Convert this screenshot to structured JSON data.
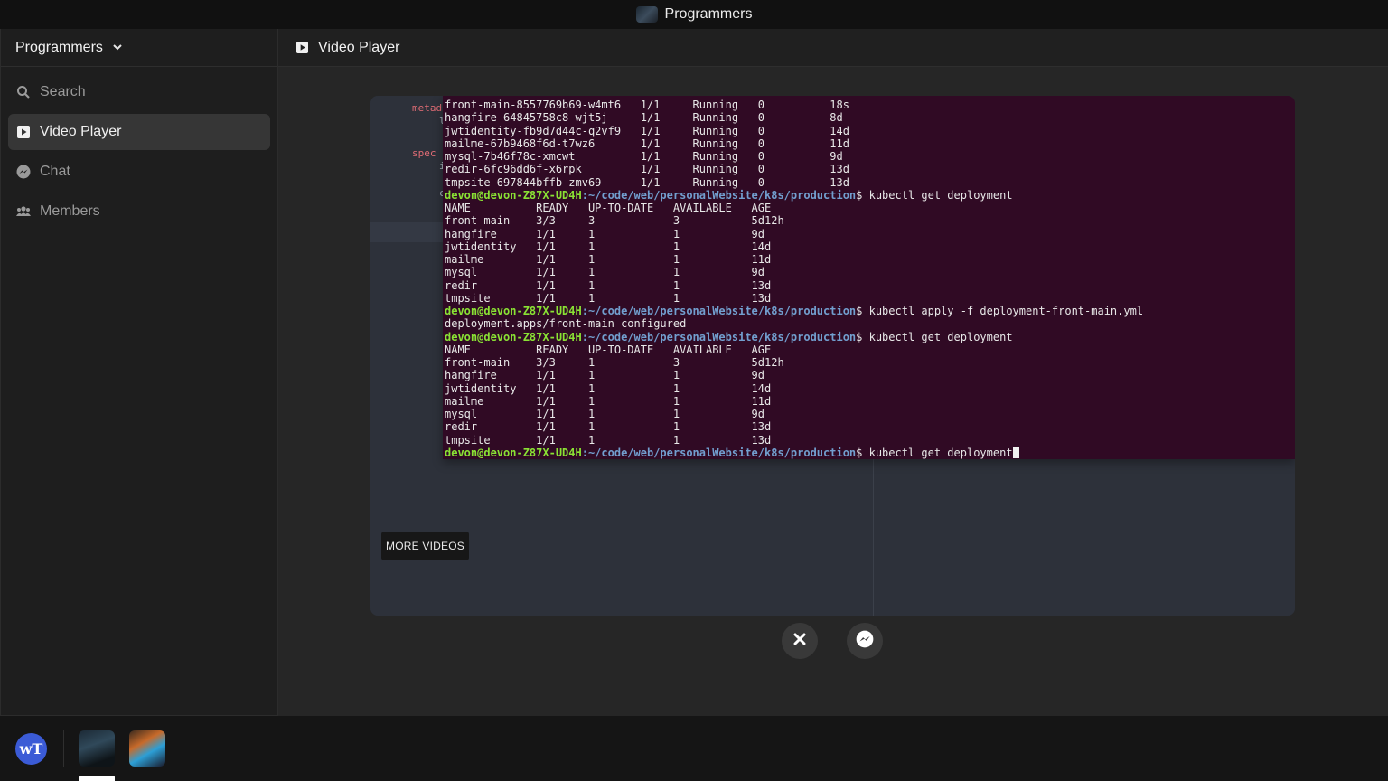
{
  "app": {
    "title": "Programmers"
  },
  "sidebar": {
    "server_name": "Programmers",
    "items": [
      {
        "label": "Search",
        "icon": "search-icon"
      },
      {
        "label": "Video Player",
        "icon": "play-square-icon",
        "active": true
      },
      {
        "label": "Chat",
        "icon": "messenger-icon"
      },
      {
        "label": "Members",
        "icon": "users-icon"
      }
    ]
  },
  "main": {
    "title": "Video Player",
    "more_videos_label": "MORE VIDEOS"
  },
  "editor": {
    "keywords": [
      "metad",
      "l",
      "spec",
      "i",
      "c"
    ]
  },
  "terminal": {
    "prompt_user": "devon@devon-Z87X-UD4H",
    "prompt_path": ":~/code/web/personalWebsite/k8s/production",
    "lines": [
      {
        "type": "out",
        "text": "front-main-8557769b69-w4mt6   1/1     Running   0          18s"
      },
      {
        "type": "out",
        "text": "hangfire-64845758c8-wjt5j     1/1     Running   0          8d"
      },
      {
        "type": "out",
        "text": "jwtidentity-fb9d7d44c-q2vf9   1/1     Running   0          14d"
      },
      {
        "type": "out",
        "text": "mailme-67b9468f6d-t7wz6       1/1     Running   0          11d"
      },
      {
        "type": "out",
        "text": "mysql-7b46f78c-xmcwt          1/1     Running   0          9d"
      },
      {
        "type": "out",
        "text": "redir-6fc96dd6f-x6rpk         1/1     Running   0          13d"
      },
      {
        "type": "out",
        "text": "tmpsite-697844bffb-zmv69      1/1     Running   0          13d"
      },
      {
        "type": "cmd",
        "text": "$ kubectl get deployment"
      },
      {
        "type": "out",
        "text": "NAME          READY   UP-TO-DATE   AVAILABLE   AGE"
      },
      {
        "type": "out",
        "text": "front-main    3/3     3            3           5d12h"
      },
      {
        "type": "out",
        "text": "hangfire      1/1     1            1           9d"
      },
      {
        "type": "out",
        "text": "jwtidentity   1/1     1            1           14d"
      },
      {
        "type": "out",
        "text": "mailme        1/1     1            1           11d"
      },
      {
        "type": "out",
        "text": "mysql         1/1     1            1           9d"
      },
      {
        "type": "out",
        "text": "redir         1/1     1            1           13d"
      },
      {
        "type": "out",
        "text": "tmpsite       1/1     1            1           13d"
      },
      {
        "type": "cmd",
        "text": "$ kubectl apply -f deployment-front-main.yml"
      },
      {
        "type": "out",
        "text": "deployment.apps/front-main configured"
      },
      {
        "type": "cmd",
        "text": "$ kubectl get deployment"
      },
      {
        "type": "out",
        "text": "NAME          READY   UP-TO-DATE   AVAILABLE   AGE"
      },
      {
        "type": "out",
        "text": "front-main    3/3     1            3           5d12h"
      },
      {
        "type": "out",
        "text": "hangfire      1/1     1            1           9d"
      },
      {
        "type": "out",
        "text": "jwtidentity   1/1     1            1           14d"
      },
      {
        "type": "out",
        "text": "mailme        1/1     1            1           11d"
      },
      {
        "type": "out",
        "text": "mysql         1/1     1            1           9d"
      },
      {
        "type": "out",
        "text": "redir         1/1     1            1           13d"
      },
      {
        "type": "out",
        "text": "tmpsite       1/1     1            1           13d"
      },
      {
        "type": "cmd",
        "text": "$ kubectl get deployment",
        "cursor": true
      }
    ]
  },
  "controls": {
    "close_icon": "close-icon",
    "chat_icon": "messenger-icon"
  },
  "taskbar": {
    "logo_text": "wT",
    "accent": "#3b5bd6"
  },
  "colors": {
    "terminal_bg": "#300a24",
    "prompt_user": "#8ae234",
    "prompt_path": "#729fcf"
  }
}
